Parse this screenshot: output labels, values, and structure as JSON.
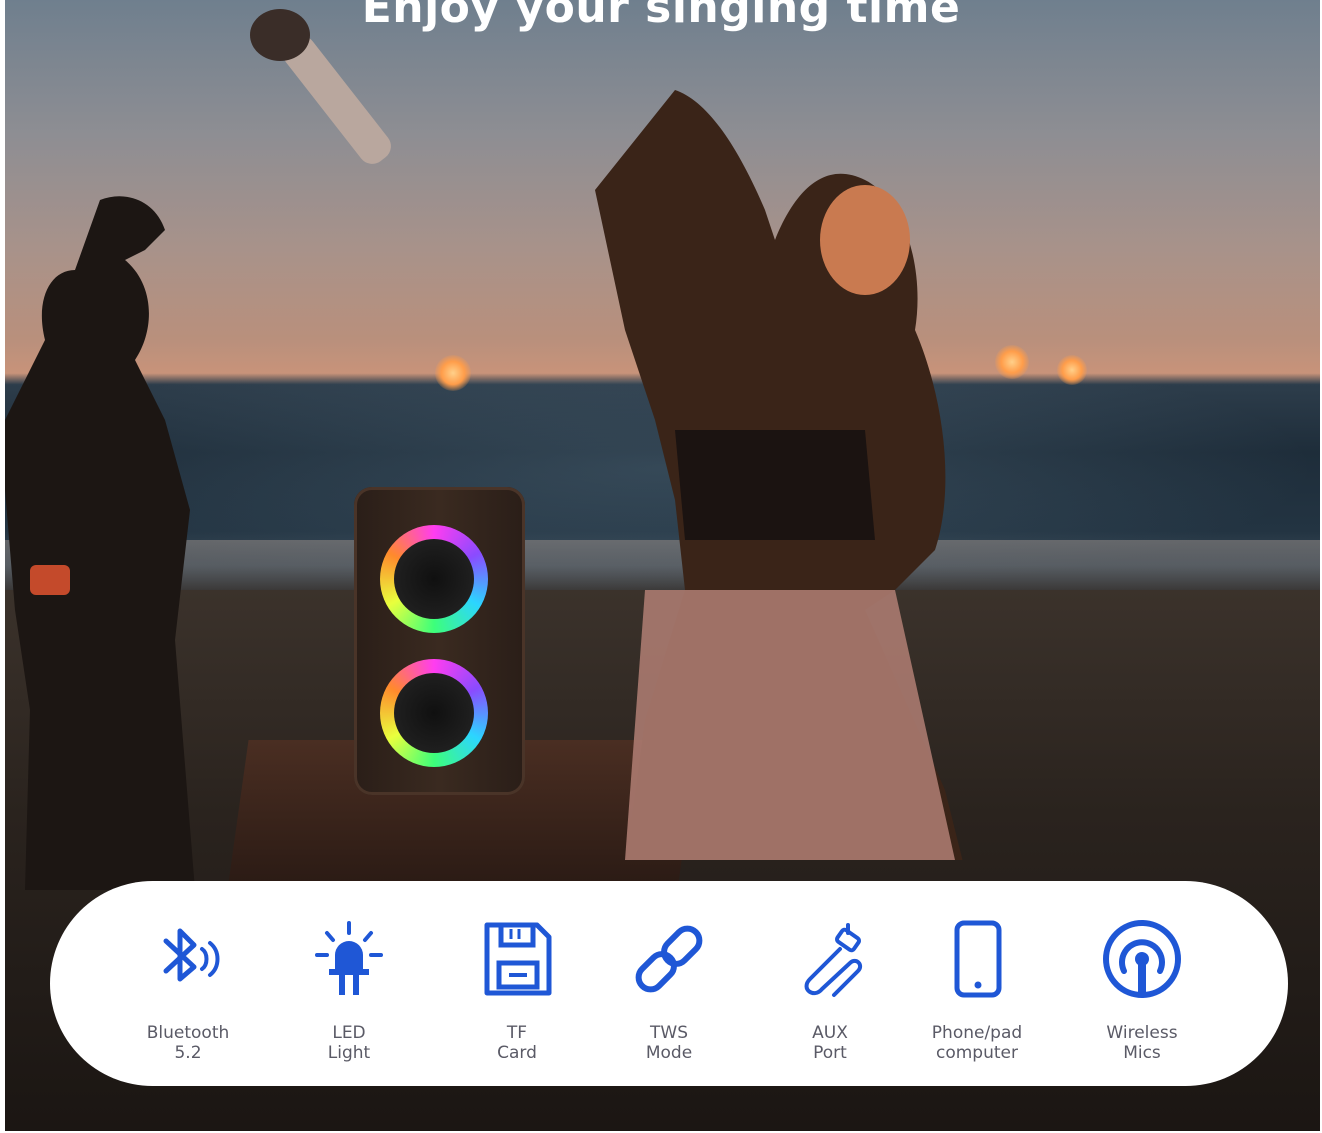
{
  "headline": "Enjoy your singing time",
  "colors": {
    "icon_blue": "#1f57d6",
    "label_gray": "#5a5a66",
    "panel_white": "#ffffff"
  },
  "features": [
    {
      "icon": "bluetooth-icon",
      "label": "Bluetooth\n5.2"
    },
    {
      "icon": "led-light-icon",
      "label": "LED\nLight"
    },
    {
      "icon": "tf-card-icon",
      "label": "TF\nCard"
    },
    {
      "icon": "link-icon",
      "label": "TWS\nMode"
    },
    {
      "icon": "aux-cable-icon",
      "label": "AUX\nPort"
    },
    {
      "icon": "phone-icon",
      "label": "Phone/pad\ncomputer"
    },
    {
      "icon": "wireless-broadcast-icon",
      "label": "Wireless\nMics"
    }
  ]
}
